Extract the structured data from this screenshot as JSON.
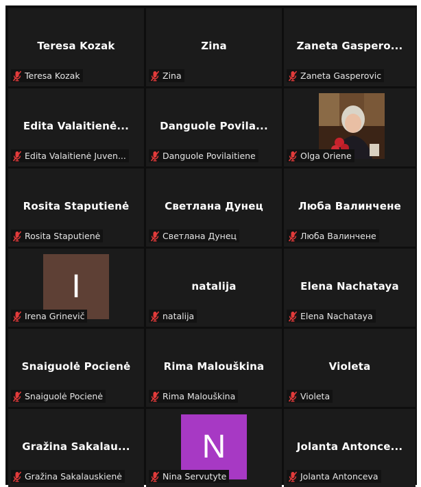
{
  "accent": {
    "mic_muted": "#e23b3b",
    "avatar_brown": "#5e4035",
    "avatar_purple": "#a739c4"
  },
  "tiles": [
    {
      "name": "Teresa Kozak",
      "label": "Teresa Kozak"
    },
    {
      "name": "Zina",
      "label": "Zina"
    },
    {
      "name": "Zaneta  Gaspero...",
      "label": "Zaneta Gasperovic"
    },
    {
      "name": "Edita  Valaitienė...",
      "label": "Edita Valaitienė Juven..."
    },
    {
      "name": "Danguole  Povila...",
      "label": "Danguole Povilaitiene"
    },
    {
      "label": "Olga Oriene"
    },
    {
      "name": "Rosita Staputienė",
      "label": "Rosita Staputienė"
    },
    {
      "name": "Светлана Дунец",
      "label": "Светлана Дунец"
    },
    {
      "name": "Люба Валинчене",
      "label": "Люба Валинчене"
    },
    {
      "avatar": "I",
      "label": "Irena Grinevič"
    },
    {
      "name": "natalija",
      "label": "natalija"
    },
    {
      "name": "Elena Nachataya",
      "label": "Elena Nachataya"
    },
    {
      "name": "Snaiguolė Pocienė",
      "label": "Snaiguolė Pocienė"
    },
    {
      "name": "Rima Malouškina",
      "label": "Rima Malouškina"
    },
    {
      "name": "Violeta",
      "label": "Violeta"
    },
    {
      "name": "Gražina  Sakalau...",
      "label": "Gražina Sakalauskienė"
    },
    {
      "avatar": "N",
      "label": "Nina Servutyte"
    },
    {
      "name": "Jolanta  Antonce...",
      "label": "Jolanta Antonceva"
    }
  ]
}
